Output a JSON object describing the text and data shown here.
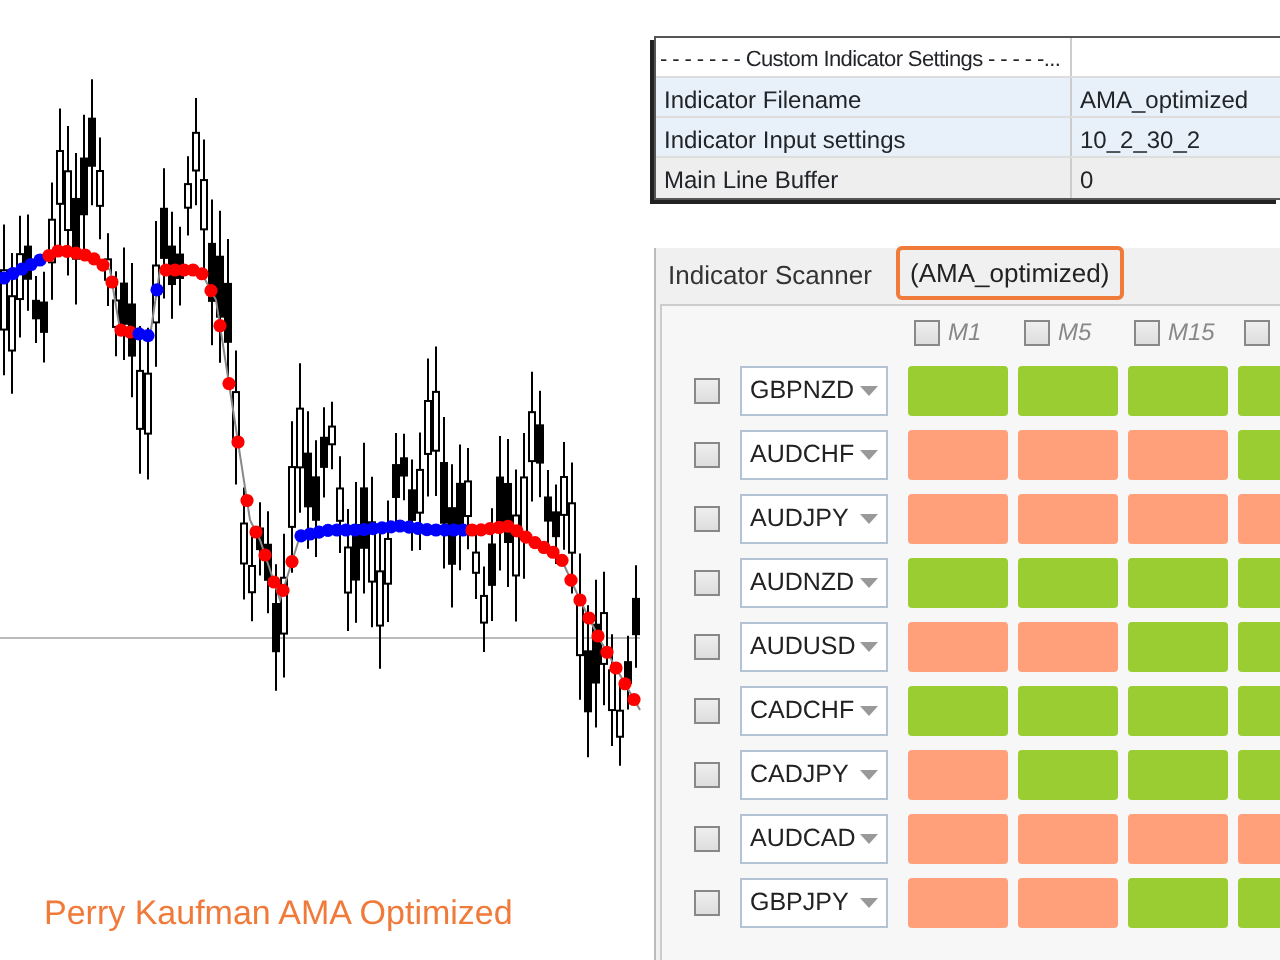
{
  "settings_table": {
    "header": "- - - - - - - Custom Indicator Settings - - - - -...",
    "rows": [
      {
        "label": "Indicator Filename",
        "value": "AMA_optimized"
      },
      {
        "label": "Indicator Input settings",
        "value": "10_2_30_2"
      },
      {
        "label": "Main Line Buffer",
        "value": "0"
      }
    ]
  },
  "scanner": {
    "title": "Indicator Scanner",
    "tab": {
      "label": "(AMA_optimized)",
      "selected": true
    },
    "timeframes": [
      {
        "label": "M1",
        "checked": false
      },
      {
        "label": "M5",
        "checked": false
      },
      {
        "label": "M15",
        "checked": false
      },
      {
        "checked": false
      }
    ],
    "rows": [
      {
        "symbol": "GBPNZD",
        "checked": false,
        "cells": [
          {
            "color": "#9acd32"
          },
          {
            "color": "#9acd32"
          },
          {
            "color": "#9acd32"
          },
          {
            "color": "#9acd32"
          }
        ]
      },
      {
        "symbol": "AUDCHF",
        "checked": false,
        "cells": [
          {
            "color": "#ffa07a"
          },
          {
            "color": "#ffa07a"
          },
          {
            "color": "#ffa07a"
          },
          {
            "color": "#9acd32"
          }
        ]
      },
      {
        "symbol": "AUDJPY",
        "checked": false,
        "cells": [
          {
            "color": "#ffa07a"
          },
          {
            "color": "#ffa07a"
          },
          {
            "color": "#ffa07a"
          },
          {
            "color": "#ffa07a"
          }
        ]
      },
      {
        "symbol": "AUDNZD",
        "checked": false,
        "cells": [
          {
            "color": "#9acd32"
          },
          {
            "color": "#9acd32"
          },
          {
            "color": "#9acd32"
          },
          {
            "color": "#9acd32"
          }
        ]
      },
      {
        "symbol": "AUDUSD",
        "checked": false,
        "cells": [
          {
            "color": "#ffa07a"
          },
          {
            "color": "#ffa07a"
          },
          {
            "color": "#9acd32"
          },
          {
            "color": "#9acd32"
          }
        ]
      },
      {
        "symbol": "CADCHF",
        "checked": false,
        "cells": [
          {
            "color": "#9acd32"
          },
          {
            "color": "#9acd32"
          },
          {
            "color": "#9acd32"
          },
          {
            "color": "#9acd32"
          }
        ]
      },
      {
        "symbol": "CADJPY",
        "checked": false,
        "cells": [
          {
            "color": "#ffa07a"
          },
          {
            "color": "#9acd32"
          },
          {
            "color": "#9acd32"
          },
          {
            "color": "#9acd32"
          }
        ]
      },
      {
        "symbol": "AUDCAD",
        "checked": false,
        "cells": [
          {
            "color": "#ffa07a"
          },
          {
            "color": "#ffa07a"
          },
          {
            "color": "#ffa07a"
          },
          {
            "color": "#ffa07a"
          }
        ]
      },
      {
        "symbol": "GBPJPY",
        "checked": false,
        "cells": [
          {
            "color": "#ffa07a"
          },
          {
            "color": "#ffa07a"
          },
          {
            "color": "#9acd32"
          },
          {
            "color": "#9acd32"
          }
        ]
      }
    ]
  },
  "caption": "Perry Kaufman AMA Optimized"
}
